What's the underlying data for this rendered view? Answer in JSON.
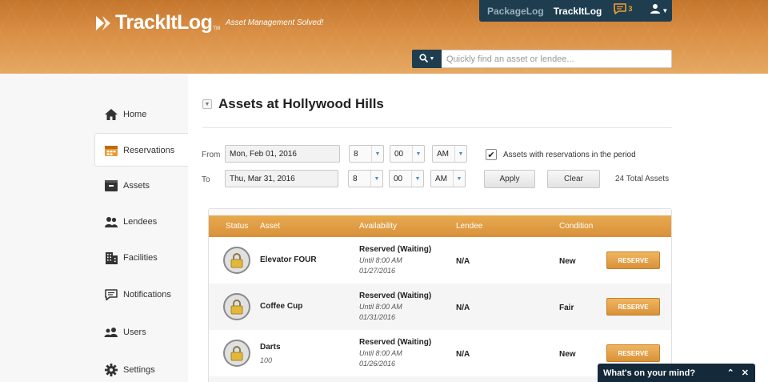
{
  "brand": {
    "name": "TrackItLog",
    "tm": "TM",
    "tagline": "Asset Management Solved!"
  },
  "topnav": {
    "links": [
      "PackageLog",
      "TrackItLog"
    ],
    "chat_count": "3"
  },
  "search": {
    "placeholder": "Quickly find an asset or lendee..."
  },
  "sidebar": {
    "items": [
      {
        "label": "Home",
        "icon": "home-icon"
      },
      {
        "label": "Reservations",
        "icon": "calendar-icon",
        "active": true
      },
      {
        "label": "Assets",
        "icon": "box-icon"
      },
      {
        "label": "Lendees",
        "icon": "people-icon"
      },
      {
        "label": "Facilities",
        "icon": "building-icon"
      },
      {
        "label": "Notifications",
        "icon": "chat-icon"
      },
      {
        "label": "Users",
        "icon": "users-icon"
      },
      {
        "label": "Settings",
        "icon": "gear-icon"
      }
    ]
  },
  "page": {
    "title": "Assets at Hollywood Hills"
  },
  "filters": {
    "from_label": "From",
    "to_label": "To",
    "from_date": "Mon, Feb 01, 2016",
    "from_hour": "8",
    "from_min": "00",
    "from_ampm": "AM",
    "to_date": "Thu, Mar 31, 2016",
    "to_hour": "8",
    "to_min": "00",
    "to_ampm": "AM",
    "checkbox_label": "Assets with reservations in the period",
    "checkbox_checked": true,
    "apply_label": "Apply",
    "clear_label": "Clear",
    "total": "24 Total Assets"
  },
  "table": {
    "headers": [
      "Status",
      "Asset",
      "Availability",
      "Lendee",
      "Condition"
    ],
    "rows": [
      {
        "asset": "Elevator FOUR",
        "sub": "",
        "availability": "Reserved (Waiting)",
        "until": "Until 8:00 AM",
        "date": "01/27/2016",
        "lendee": "N/A",
        "condition": "New",
        "action": "RESERVE"
      },
      {
        "asset": "Coffee Cup",
        "sub": "",
        "availability": "Reserved (Waiting)",
        "until": "Until 8:00 AM",
        "date": "01/31/2016",
        "lendee": "N/A",
        "condition": "Fair",
        "action": "RESERVE"
      },
      {
        "asset": "Darts",
        "sub": "100",
        "availability": "Reserved (Waiting)",
        "until": "Until 8:00 AM",
        "date": "01/26/2016",
        "lendee": "N/A",
        "condition": "New",
        "action": "RESERVE"
      }
    ]
  },
  "chat_widget": {
    "label": "What's on your mind?"
  },
  "colors": {
    "accent": "#d9913a",
    "nav_dark": "#1e3d4f",
    "chat_dark": "#14293a"
  }
}
